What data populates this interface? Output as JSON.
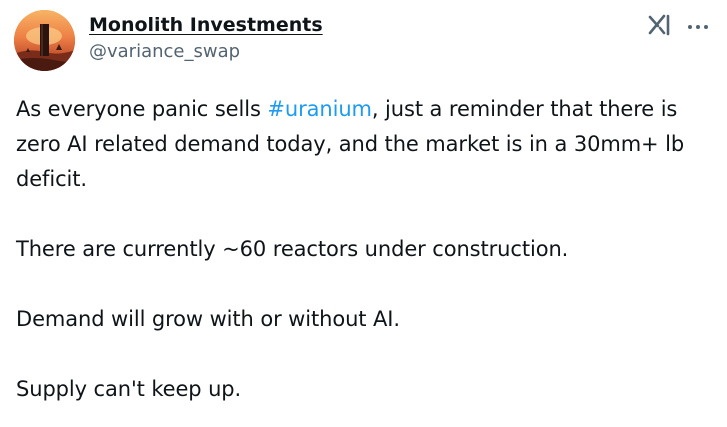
{
  "author": {
    "display_name": "Monolith Investments",
    "handle": "@variance_swap",
    "avatar_icon": "monolith-sunset-avatar"
  },
  "actions": {
    "grok_icon": "grok-icon",
    "more_icon": "more-options-icon"
  },
  "tweet": {
    "p1_before": "As everyone panic sells ",
    "hashtag": "#uranium",
    "p1_after": ", just a reminder that there is zero AI related demand today, and the market is in a 30mm+ lb deficit.",
    "p2": "There are currently ~60 reactors under construction.",
    "p3": "Demand will grow with or without AI.",
    "p4": "Supply can't keep up."
  },
  "colors": {
    "text": "#0f1419",
    "secondary": "#536471",
    "link": "#1d9bf0",
    "background": "#ffffff"
  }
}
